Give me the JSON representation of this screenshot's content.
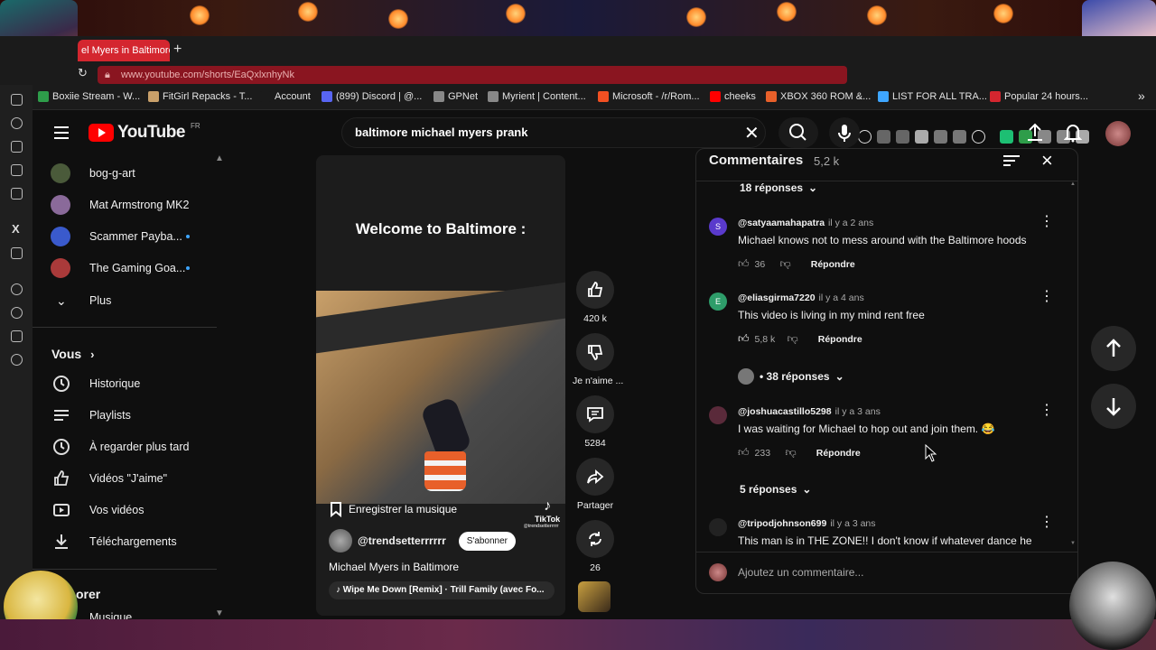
{
  "browser": {
    "tab_title": "el Myers in Baltimore",
    "new_tab": "+",
    "url": "www.youtube.com/shorts/EaQxlxnhyNk",
    "bookmarks": [
      {
        "label": "Boxiie Stream - W...",
        "color": "#2e9d4a"
      },
      {
        "label": "FitGirl Repacks - T...",
        "color": "#c9a06a"
      },
      {
        "label": "Account",
        "color": "#1b1b1b"
      },
      {
        "label": "(899) Discord | @...",
        "color": "#5865f2"
      },
      {
        "label": "GPNet",
        "color": "#888888"
      },
      {
        "label": "Myrient | Content...",
        "color": "#888888"
      },
      {
        "label": "Microsoft - /r/Rom...",
        "color": "#f25022"
      },
      {
        "label": "cheeks",
        "color": "#ff0000"
      },
      {
        "label": "XBOX 360 ROM &...",
        "color": "#e8602a"
      },
      {
        "label": "LIST FOR ALL TRA...",
        "color": "#3ea6ff"
      },
      {
        "label": "Popular 24 hours...",
        "color": "#d4262f"
      }
    ],
    "more_bookmarks": "»"
  },
  "youtube": {
    "logo_text": "YouTube",
    "logo_region": "FR",
    "search_query": "baltimore michael myers prank",
    "clear_icon": "✕"
  },
  "sidebar": {
    "subscriptions": [
      {
        "label": "bog-g-art",
        "avatar": "#4a5a3a",
        "dot": false
      },
      {
        "label": "Mat Armstrong MK2",
        "avatar": "#8a6a9a",
        "dot": false
      },
      {
        "label": "Scammer Payba...",
        "avatar": "#3a5acc",
        "dot": true
      },
      {
        "label": "The Gaming Goa...",
        "avatar": "#aa3a3a",
        "dot": true
      }
    ],
    "more_label": "Plus",
    "you_heading": "Vous",
    "you_items": [
      {
        "label": "Historique"
      },
      {
        "label": "Playlists"
      },
      {
        "label": "À regarder plus tard"
      },
      {
        "label": "Vidéos \"J'aime\""
      },
      {
        "label": "Vos vidéos"
      },
      {
        "label": "Téléchargements"
      }
    ],
    "explore_partial": "orer",
    "music_partial": "Musique"
  },
  "short": {
    "overlay_title": "Welcome to Baltimore :",
    "save_music": "Enregistrer la musique",
    "tiktok_label": "TikTok",
    "tiktok_handle": "@trendsetterrrrr",
    "channel": "@trendsetterrrrrr",
    "subscribe": "S'abonner",
    "caption": "Michael Myers in Baltimore",
    "song": "Wipe Me Down [Remix] · Trill Family (avec Fo..."
  },
  "actions": {
    "likes": "420 k",
    "dislike_label": "Je n'aime ...",
    "comments": "5284",
    "share": "Partager",
    "remix": "26"
  },
  "comments_panel": {
    "title": "Commentaires",
    "count": "5,2 k",
    "top_replies": "18 réponses",
    "items": [
      {
        "initial": "S",
        "color": "#5a3acc",
        "user": "@satyaamahapatra",
        "time": "il y a 2 ans",
        "text": "Michael knows not to mess around with the Baltimore hoods",
        "likes": "36",
        "reply": "Répondre"
      },
      {
        "initial": "E",
        "color": "#2e9d6a",
        "user": "@eliasgirma7220",
        "time": "il y a 4 ans",
        "text": "This video is living in my mind rent free",
        "likes": "5,8 k",
        "reply": "Répondre"
      },
      {
        "initial": "",
        "color": "#5a2a3a",
        "user": "@joshuacastillo5298",
        "time": "il y a 3 ans",
        "text": "I was waiting for Michael to hop out and join them. 😂",
        "likes": "233",
        "reply": "Répondre"
      },
      {
        "initial": "",
        "color": "#222222",
        "user": "@tripodjohnson699",
        "time": "il y a 3 ans",
        "text": "This man is in THE ZONE!! I don't know if whatever dance he",
        "likes": "",
        "reply": ""
      }
    ],
    "replies_2": "• 38 réponses",
    "replies_3": "5 réponses",
    "add_comment": "Ajoutez un commentaire..."
  },
  "colors": {
    "accent_red": "#ff0000",
    "link_blue": "#3ea6ff",
    "bg": "#0f0f0f"
  }
}
